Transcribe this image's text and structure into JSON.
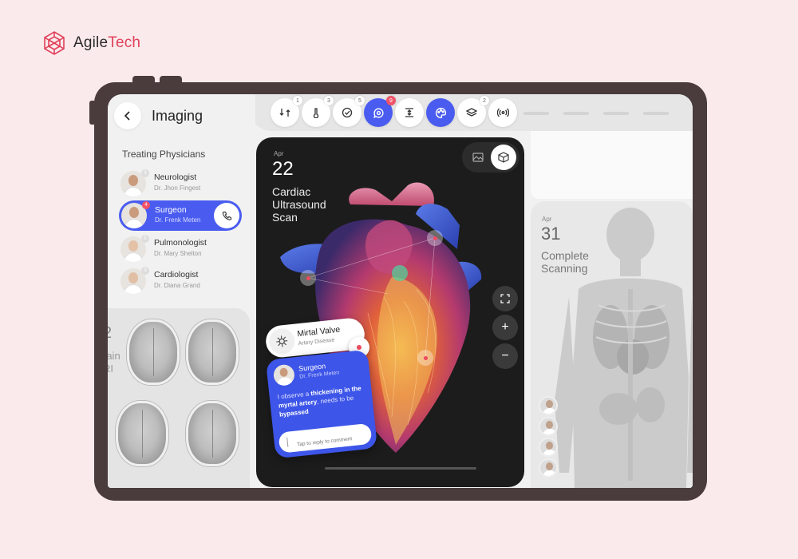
{
  "brand": {
    "name_part1": "Agile",
    "name_part2": "Tech",
    "logo_icon": "geodesic-globe-icon",
    "accent": "#e0415a"
  },
  "header": {
    "title": "Imaging",
    "back_icon": "chevron-left-icon"
  },
  "toolbar": [
    {
      "icon": "transfer-icon",
      "badge": "1"
    },
    {
      "icon": "thermometer-icon",
      "badge": "3"
    },
    {
      "icon": "check-circle-icon",
      "badge": "5"
    },
    {
      "icon": "chat-search-icon",
      "badge": "9",
      "active": true,
      "badge_color": "#f05368"
    },
    {
      "icon": "text-height-icon",
      "badge": ""
    },
    {
      "icon": "palette-icon",
      "badge": "",
      "active": true
    },
    {
      "icon": "layers-icon",
      "badge": "2"
    },
    {
      "icon": "broadcast-icon",
      "badge": ""
    }
  ],
  "physicians": {
    "title": "Treating Physicians",
    "items": [
      {
        "role": "Neurologist",
        "name": "Dr. Jhon Fingest",
        "num": "3"
      },
      {
        "role": "Surgeon",
        "name": "Dr. Frenk Meten",
        "num": "4",
        "selected": true
      },
      {
        "role": "Pulmonologist",
        "name": "Dr. Mary Shelton",
        "num": "5"
      },
      {
        "role": "Cardiologist",
        "name": "Dr. Diana Grand",
        "num": "3"
      }
    ]
  },
  "mri_card": {
    "day_fragment": "2",
    "line1": "rain",
    "line2": "RI"
  },
  "heart_card": {
    "month": "Apr",
    "day": "22",
    "title": "Cardiac Ultrasound Scan",
    "zoom_in": "+",
    "zoom_out": "−"
  },
  "valve": {
    "name": "Mirtal Valve",
    "sub": "Artery Disease"
  },
  "comment": {
    "role": "Surgeon",
    "name": "Dr. Frenk Meten",
    "text_a": "I observe a ",
    "text_b": "thickening in the myrtal artery",
    "text_c": ", needs to be ",
    "text_d": "bypassed",
    "reply_placeholder": "Tap to reply to comment"
  },
  "scan_card": {
    "month": "Apr",
    "day": "31",
    "title": "Complete Scanning"
  },
  "colors": {
    "primary": "#4a5cf0",
    "device": "#4a3c3c",
    "background": "#fbeaec"
  }
}
